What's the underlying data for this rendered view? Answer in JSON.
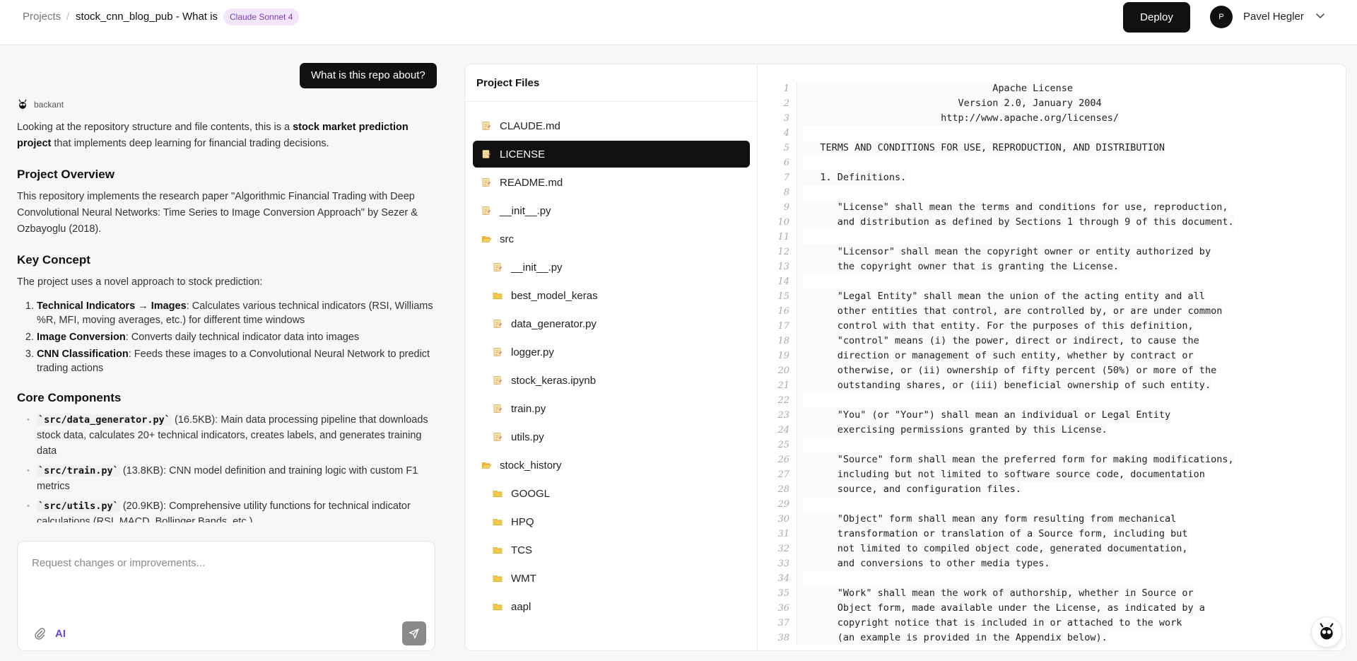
{
  "header": {
    "projects_label": "Projects",
    "separator": "/",
    "project_title": "stock_cnn_blog_pub - What is",
    "model_badge": "Claude Sonnet 4",
    "deploy_label": "Deploy",
    "avatar_initial": "P",
    "user_name": "Pavel Hegler"
  },
  "chat": {
    "user_message": "What is this repo about?",
    "bot_name": "backant",
    "intro_before": "Looking at the repository structure and file contents, this is a ",
    "intro_bold": "stock market prediction project",
    "intro_after": " that implements deep learning for financial trading decisions.",
    "overview_heading": "Project Overview",
    "overview_text": "This repository implements the research paper \"Algorithmic Financial Trading with Deep Convolutional Neural Networks: Time Series to Image Conversion Approach\" by Sezer & Ozbayoglu (2018).",
    "key_heading": "Key Concept",
    "key_text": "The project uses a novel approach to stock prediction:",
    "key_items": [
      {
        "bold": "Technical Indicators → Images",
        "text": ": Calculates various technical indicators (RSI, Williams %R, MFI, moving averages, etc.) for different time windows"
      },
      {
        "bold": "Image Conversion",
        "text": ": Converts daily technical indicator data into images"
      },
      {
        "bold": "CNN Classification",
        "text": ": Feeds these images to a Convolutional Neural Network to predict trading actions"
      }
    ],
    "core_heading": "Core Components",
    "core_items": [
      {
        "code": "`src/data_generator.py`",
        "text": " (16.5KB): Main data processing pipeline that downloads stock data, calculates 20+ technical indicators, creates labels, and generates training data"
      },
      {
        "code": "`src/train.py`",
        "text": " (13.8KB): CNN model definition and training logic with custom F1 metrics"
      },
      {
        "code": "`src/utils.py`",
        "text": " (20.9KB): Comprehensive utility functions for technical indicator calculations (RSI, MACD, Bollinger Bands, etc.)"
      }
    ],
    "composer_placeholder": "Request changes or improvements...",
    "ai_label": "AI"
  },
  "files": {
    "title": "Project Files",
    "items": [
      {
        "name": "CLAUDE.md",
        "type": "file",
        "depth": 0,
        "active": false
      },
      {
        "name": "LICENSE",
        "type": "file",
        "depth": 0,
        "active": true
      },
      {
        "name": "README.md",
        "type": "file",
        "depth": 0,
        "active": false
      },
      {
        "name": "__init__.py",
        "type": "file",
        "depth": 0,
        "active": false
      },
      {
        "name": "src",
        "type": "folder-open",
        "depth": 0,
        "active": false
      },
      {
        "name": "__init__.py",
        "type": "file",
        "depth": 1,
        "active": false
      },
      {
        "name": "best_model_keras",
        "type": "folder",
        "depth": 1,
        "active": false
      },
      {
        "name": "data_generator.py",
        "type": "file",
        "depth": 1,
        "active": false
      },
      {
        "name": "logger.py",
        "type": "file",
        "depth": 1,
        "active": false
      },
      {
        "name": "stock_keras.ipynb",
        "type": "file",
        "depth": 1,
        "active": false
      },
      {
        "name": "train.py",
        "type": "file",
        "depth": 1,
        "active": false
      },
      {
        "name": "utils.py",
        "type": "file",
        "depth": 1,
        "active": false
      },
      {
        "name": "stock_history",
        "type": "folder-open",
        "depth": 0,
        "active": false
      },
      {
        "name": "GOOGL",
        "type": "folder",
        "depth": 1,
        "active": false
      },
      {
        "name": "HPQ",
        "type": "folder",
        "depth": 1,
        "active": false
      },
      {
        "name": "TCS",
        "type": "folder",
        "depth": 1,
        "active": false
      },
      {
        "name": "WMT",
        "type": "folder",
        "depth": 1,
        "active": false
      },
      {
        "name": "aapl",
        "type": "folder",
        "depth": 1,
        "active": false
      }
    ]
  },
  "code": {
    "lines": [
      "                                 Apache License",
      "                           Version 2.0, January 2004",
      "                        http://www.apache.org/licenses/",
      "",
      "   TERMS AND CONDITIONS FOR USE, REPRODUCTION, AND DISTRIBUTION",
      "",
      "   1. Definitions.",
      "",
      "      \"License\" shall mean the terms and conditions for use, reproduction,",
      "      and distribution as defined by Sections 1 through 9 of this document.",
      "",
      "      \"Licensor\" shall mean the copyright owner or entity authorized by",
      "      the copyright owner that is granting the License.",
      "",
      "      \"Legal Entity\" shall mean the union of the acting entity and all",
      "      other entities that control, are controlled by, or are under common",
      "      control with that entity. For the purposes of this definition,",
      "      \"control\" means (i) the power, direct or indirect, to cause the",
      "      direction or management of such entity, whether by contract or",
      "      otherwise, or (ii) ownership of fifty percent (50%) or more of the",
      "      outstanding shares, or (iii) beneficial ownership of such entity.",
      "",
      "      \"You\" (or \"Your\") shall mean an individual or Legal Entity",
      "      exercising permissions granted by this License.",
      "",
      "      \"Source\" form shall mean the preferred form for making modifications,",
      "      including but not limited to software source code, documentation",
      "      source, and configuration files.",
      "",
      "      \"Object\" form shall mean any form resulting from mechanical",
      "      transformation or translation of a Source form, including but",
      "      not limited to compiled object code, generated documentation,",
      "      and conversions to other media types.",
      "",
      "      \"Work\" shall mean the work of authorship, whether in Source or",
      "      Object form, made available under the License, as indicated by a",
      "      copyright notice that is included in or attached to the work",
      "      (an example is provided in the Appendix below)."
    ]
  }
}
